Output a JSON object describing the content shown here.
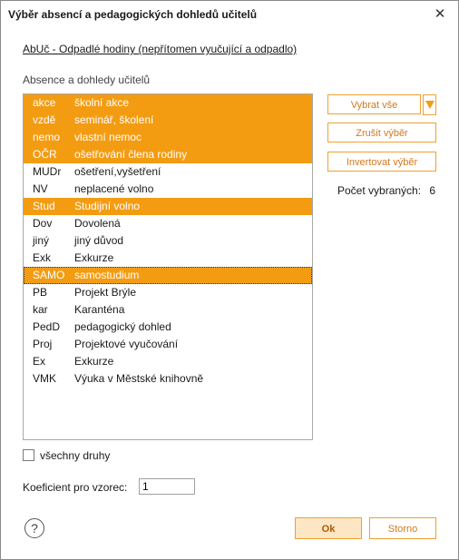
{
  "window": {
    "title": "Výběr absencí a pedagogických dohledů učitelů",
    "close_glyph": "✕"
  },
  "subtitle": "AbUč - Odpadlé hodiny (nepřítomen vyučující a odpadlo)",
  "group_label": "Absence a dohledy učitelů",
  "items": [
    {
      "code": "akce",
      "name": "školní akce",
      "selected": true
    },
    {
      "code": "vzdě",
      "name": "seminář, školení",
      "selected": true
    },
    {
      "code": "nemo",
      "name": "vlastní nemoc",
      "selected": true
    },
    {
      "code": "OČR",
      "name": "ošetřování člena rodiny",
      "selected": true
    },
    {
      "code": "MUDr",
      "name": "ošetření,vyšetření",
      "selected": false
    },
    {
      "code": "NV",
      "name": "neplacené volno",
      "selected": false
    },
    {
      "code": "Stud",
      "name": "Studijní volno",
      "selected": true
    },
    {
      "code": "Dov",
      "name": "Dovolená",
      "selected": false
    },
    {
      "code": "jiný",
      "name": "jiný důvod",
      "selected": false
    },
    {
      "code": "Exk",
      "name": "Exkurze",
      "selected": false
    },
    {
      "code": "SAMO",
      "name": "samostudium",
      "selected": true
    },
    {
      "code": "PB",
      "name": "Projekt Brýle",
      "selected": false
    },
    {
      "code": "kar",
      "name": "Karanténa",
      "selected": false
    },
    {
      "code": "PedD",
      "name": "pedagogický dohled",
      "selected": false
    },
    {
      "code": "Proj",
      "name": "Projektové vyučování",
      "selected": false
    },
    {
      "code": "Ex",
      "name": "Exkurze",
      "selected": false
    },
    {
      "code": "VMK",
      "name": "Výuka v Městské knihovně",
      "selected": false
    }
  ],
  "buttons": {
    "select_all": "Vybrat vše",
    "deselect": "Zrušit výběr",
    "invert": "Invertovat výběr",
    "ok": "Ok",
    "cancel": "Storno"
  },
  "selected_count": {
    "label": "Počet vybraných:",
    "value": "6"
  },
  "all_types_checkbox": {
    "label": "všechny druhy",
    "checked": false
  },
  "coefficient": {
    "label": "Koeficient pro vzorec:",
    "value": "1"
  },
  "help_glyph": "?",
  "colors": {
    "selection": "#f39c12",
    "accent_border": "#f0a030"
  }
}
